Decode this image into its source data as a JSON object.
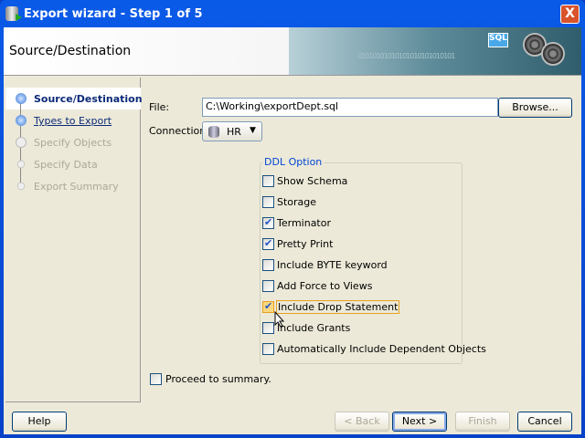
{
  "window": {
    "title": "Export wizard - Step 1 of 5",
    "close": "X"
  },
  "header": {
    "title": "Source/Destination",
    "banner_text": "01010101010101010101010101",
    "sql_label": "SQL"
  },
  "nav": {
    "steps": [
      {
        "label": "Source/Destination",
        "state": "current"
      },
      {
        "label": "Types to Export",
        "state": "link"
      },
      {
        "label": "Specify Objects",
        "state": "disabled"
      },
      {
        "label": "Specify Data",
        "state": "disabled"
      },
      {
        "label": "Export Summary",
        "state": "disabled"
      }
    ]
  },
  "form": {
    "file_label": "File:",
    "file_value": "C:\\Working\\exportDept.sql",
    "browse": "Browse...",
    "connection_label": "Connection:",
    "connection_value": "HR"
  },
  "ddl": {
    "legend": "DDL Option",
    "options": [
      {
        "label": "Show Schema",
        "checked": false
      },
      {
        "label": "Storage",
        "checked": false
      },
      {
        "label": "Terminator",
        "checked": true
      },
      {
        "label": "Pretty Print",
        "checked": true
      },
      {
        "label": "Include BYTE keyword",
        "checked": false
      },
      {
        "label": "Add Force to Views",
        "checked": false
      },
      {
        "label": "Include Drop Statement",
        "checked": true
      },
      {
        "label": "Include Grants",
        "checked": false
      },
      {
        "label": "Automatically Include Dependent Objects",
        "checked": false
      }
    ]
  },
  "proceed": {
    "label": "Proceed to summary.",
    "checked": false
  },
  "buttons": {
    "help": "Help",
    "back": "< Back",
    "next": "Next >",
    "finish": "Finish",
    "cancel": "Cancel"
  }
}
